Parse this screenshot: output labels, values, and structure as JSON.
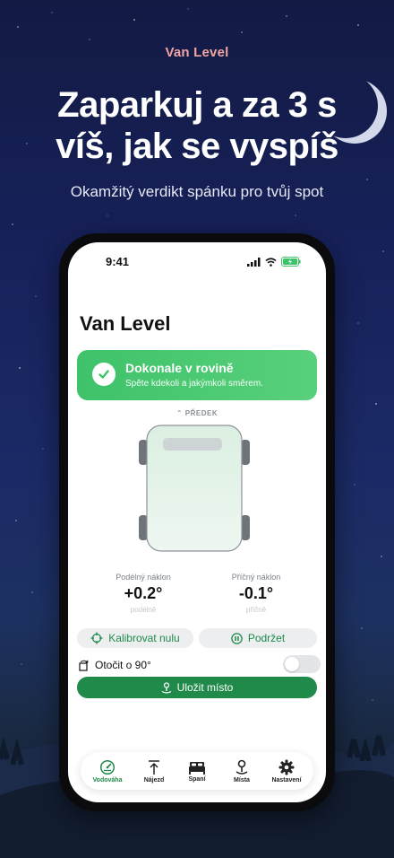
{
  "hero": {
    "eyebrow": "Van Level",
    "headline_line1": "Zaparkuj a za 3 s",
    "headline_line2": "víš, jak se vyspíš",
    "subheadline": "Okamžitý verdikt spánku pro tvůj spot"
  },
  "status_bar": {
    "time": "9:41"
  },
  "app": {
    "title": "Van Level",
    "verdict": {
      "title": "Dokonale v rovině",
      "subtitle": "Spěte kdekoli a jakýmkoli směrem.",
      "color": "#45C66F"
    },
    "front_label": "PŘEDEK",
    "pitch": {
      "label": "Podélný náklon",
      "value": "+0.2°",
      "unit_label": "podélně"
    },
    "roll": {
      "label": "Příčný náklon",
      "value": "-0.1°",
      "unit_label": "příčně"
    },
    "calibrate_label": "Kalibrovat nulu",
    "hold_label": "Podržet",
    "rotate_label": "Otočit o 90°",
    "rotate_enabled": false,
    "save_label": "Uložit místo",
    "accent": "#1F8A4A"
  },
  "tabs": [
    {
      "label": "Vodováha",
      "icon": "gauge-icon",
      "active": true
    },
    {
      "label": "Nájezd",
      "icon": "ramp-arrow-icon",
      "active": false
    },
    {
      "label": "Spaní",
      "icon": "bed-icon",
      "active": false
    },
    {
      "label": "Místa",
      "icon": "map-pin-icon",
      "active": false
    },
    {
      "label": "Nastavení",
      "icon": "gear-icon",
      "active": false
    }
  ]
}
